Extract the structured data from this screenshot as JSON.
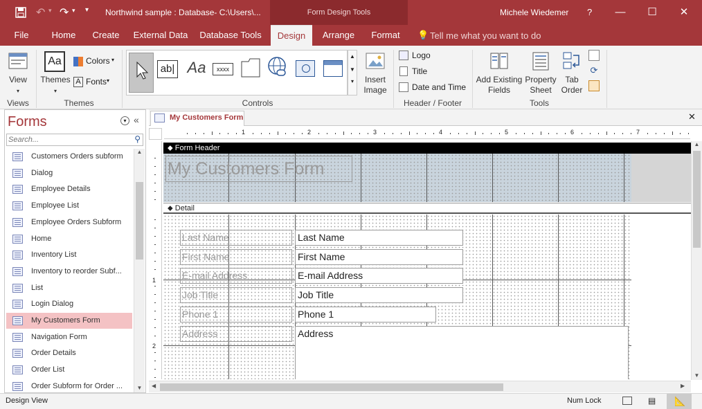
{
  "titlebar": {
    "doc_title": "Northwind sample : Database- C:\\Users\\...",
    "context_tab": "Form Design Tools",
    "user": "Michele Wiedemer",
    "help": "?",
    "minimize": "—",
    "restore": "☐",
    "close": "✕"
  },
  "tabs": [
    "File",
    "Home",
    "Create",
    "External Data",
    "Database Tools",
    "Design",
    "Arrange",
    "Format"
  ],
  "tell_me": "Tell me what you want to do",
  "ribbon": {
    "view": "View",
    "themes": "Themes",
    "colors": "Colors",
    "fonts": "Fonts",
    "insert_image": [
      "Insert",
      "Image"
    ],
    "logo": "Logo",
    "title": "Title",
    "date_time": "Date and Time",
    "add_fields": [
      "Add Existing",
      "Fields"
    ],
    "property_sheet": [
      "Property",
      "Sheet"
    ],
    "tab_order": [
      "Tab",
      "Order"
    ],
    "groups": {
      "views": "Views",
      "themes": "Themes",
      "controls": "Controls",
      "header_footer": "Header / Footer",
      "tools": "Tools"
    }
  },
  "nav": {
    "title": "Forms",
    "search_placeholder": "Search...",
    "items": [
      "Customers Orders subform",
      "Dialog",
      "Employee Details",
      "Employee List",
      "Employee Orders Subform",
      "Home",
      "Inventory List",
      "Inventory to reorder Subf...",
      "List",
      "Login Dialog",
      "My Customers Form",
      "Navigation Form",
      "Order Details",
      "Order List",
      "Order Subform for Order ..."
    ],
    "selected_index": 10
  },
  "document": {
    "tab_title": "My Customers Form",
    "form_header_label": "Form Header",
    "detail_label": "Detail",
    "form_title": "My Customers Form",
    "ruler_numbers": [
      "1",
      "2",
      "3",
      "4",
      "5",
      "6",
      "7"
    ],
    "vruler_numbers": [
      "1",
      "2"
    ],
    "fields": [
      {
        "label": "Last Name",
        "value": "Last Name"
      },
      {
        "label": "First Name",
        "value": "First Name"
      },
      {
        "label": "E-mail Address",
        "value": "E-mail Address"
      },
      {
        "label": "Job Title",
        "value": "Job Title"
      },
      {
        "label": "Phone 1",
        "value": "Phone 1"
      },
      {
        "label": "Address",
        "value": "Address"
      }
    ]
  },
  "status": {
    "left": "Design View",
    "numlock": "Num Lock"
  },
  "colors": {
    "accent": "#a4373a",
    "context": "#8b2a2d",
    "selected": "#f4c2c4"
  }
}
